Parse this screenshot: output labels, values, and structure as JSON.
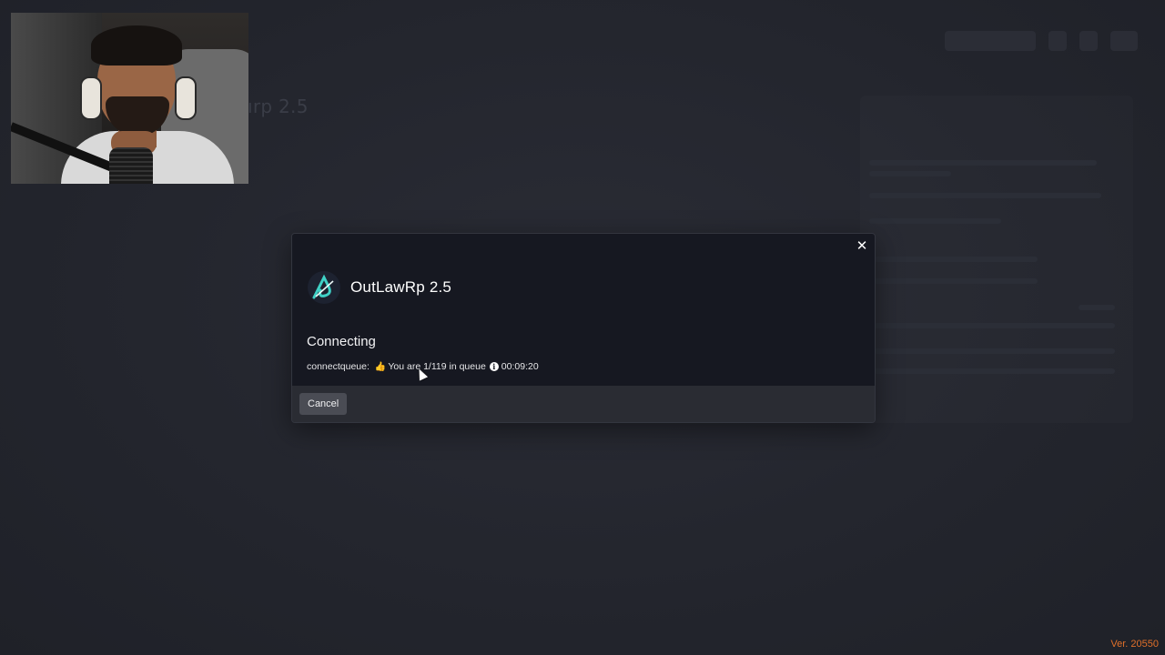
{
  "background": {
    "server_title_fragment": "ırp 2.5"
  },
  "modal": {
    "server_name": "OutLawRp 2.5",
    "status_title": "Connecting",
    "queue": {
      "prefix": "connectqueue:",
      "emoji": "👍",
      "message": "You are 1/119 in queue",
      "timer": "00:09:20"
    },
    "close_icon": "close-icon",
    "cancel_label": "Cancel"
  },
  "footer": {
    "version": "Ver. 20550"
  },
  "colors": {
    "modal_body": "#161821",
    "modal_footer": "#2a2c33",
    "cancel_button": "#4a4c54",
    "version_text": "#e0702a",
    "logo_accent": "#3fd1c6"
  }
}
